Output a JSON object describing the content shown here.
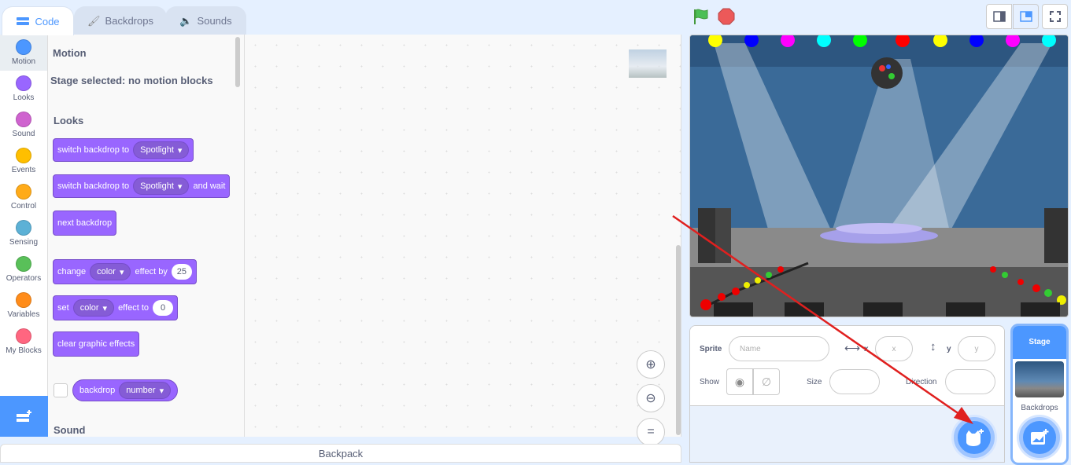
{
  "tabs": [
    {
      "label": "Code",
      "icon": "code-icon"
    },
    {
      "label": "Backdrops",
      "icon": "brush-icon"
    },
    {
      "label": "Sounds",
      "icon": "speaker-icon"
    }
  ],
  "categories": [
    {
      "label": "Motion",
      "color": "#4c97ff"
    },
    {
      "label": "Looks",
      "color": "#9966ff"
    },
    {
      "label": "Sound",
      "color": "#cf63cf"
    },
    {
      "label": "Events",
      "color": "#ffbf00"
    },
    {
      "label": "Control",
      "color": "#ffab19"
    },
    {
      "label": "Sensing",
      "color": "#5cb1d6"
    },
    {
      "label": "Operators",
      "color": "#59c059"
    },
    {
      "label": "Variables",
      "color": "#ff8c1a"
    },
    {
      "label": "My Blocks",
      "color": "#ff6680"
    }
  ],
  "palette": {
    "motion_heading": "Motion",
    "motion_note": "Stage selected: no motion blocks",
    "looks_heading": "Looks",
    "sound_heading": "Sound",
    "blocks": {
      "switch1": {
        "text": "switch backdrop to",
        "menu": "Spotlight"
      },
      "switch2": {
        "text": "switch backdrop to",
        "menu": "Spotlight",
        "suffix": "and wait"
      },
      "next": {
        "text": "next backdrop"
      },
      "change": {
        "text": "change",
        "menu": "color",
        "mid": "effect by",
        "value": "25"
      },
      "set": {
        "text": "set",
        "menu": "color",
        "mid": "effect to",
        "value": "0"
      },
      "clear": {
        "text": "clear graphic effects"
      },
      "backdrop": {
        "text": "backdrop",
        "menu": "number"
      }
    }
  },
  "backpack": "Backpack",
  "sprite_info": {
    "sprite_label": "Sprite",
    "name_placeholder": "Name",
    "x_label": "x",
    "x_placeholder": "x",
    "y_label": "y",
    "y_placeholder": "y",
    "show_label": "Show",
    "size_label": "Size",
    "direction_label": "Direction"
  },
  "stage_selector": {
    "title": "Stage",
    "backdrops_label": "Backdrops"
  },
  "colors": {
    "accent": "#4c97ff",
    "looks": "#9966ff",
    "arrow": "#e0201f"
  }
}
